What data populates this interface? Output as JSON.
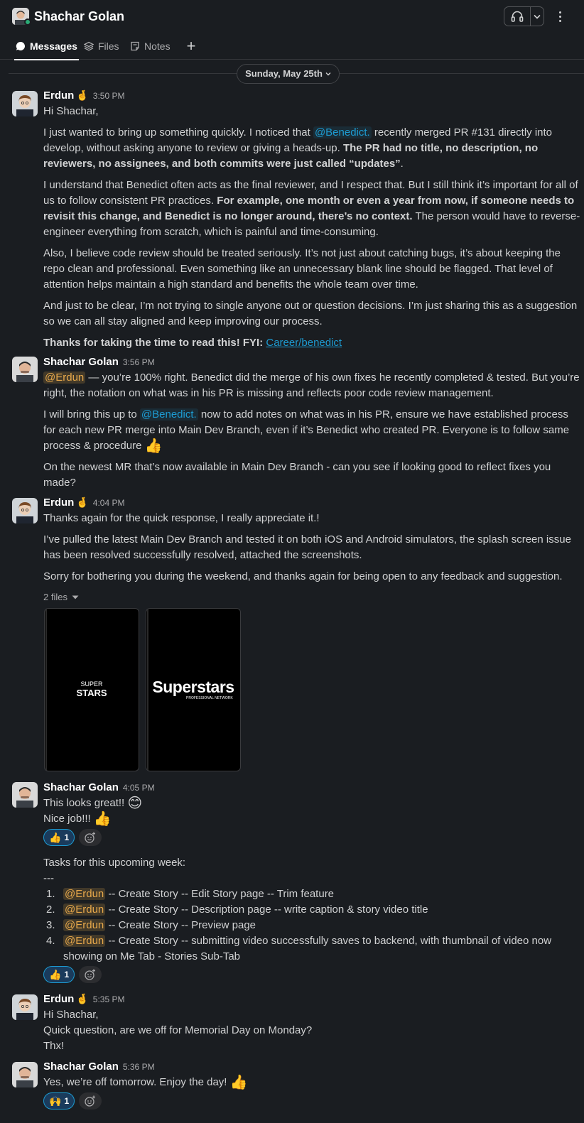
{
  "header": {
    "title": "Shachar Golan",
    "status_color": "#2bac76"
  },
  "tabs": [
    {
      "label": "Messages",
      "icon": "chat-bubble-icon",
      "active": true
    },
    {
      "label": "Files",
      "icon": "layers-icon",
      "active": false
    },
    {
      "label": "Notes",
      "icon": "note-icon",
      "active": false
    }
  ],
  "date_divider": "Sunday, May 25th",
  "messages": {
    "m1": {
      "name": "Erdun",
      "status_emoji": "🤞",
      "time": "3:50 PM",
      "greeting": "Hi Shachar,",
      "p1_a": "I just wanted to bring up something quickly. I noticed that ",
      "p1_mention": "@Benedict.",
      "p1_b": " recently merged PR #131 directly into develop, without asking anyone to review or giving a heads-up. ",
      "p1_bold": "The PR had no title, no description, no reviewers, no assignees, and both commits were just called “updates”",
      "p1_end": ".",
      "p2_a": "I understand that Benedict often acts as the final reviewer, and I respect that. But I still think it’s important for all of us to follow consistent PR practices. ",
      "p2_bold": "For example, one month or even a year from now, if someone needs to revisit this change, and Benedict is no longer around, there’s no context.",
      "p2_b": " The person would have to reverse-engineer everything from scratch, which is painful and time-consuming.",
      "p3": "Also, I believe code review should be treated seriously. It’s not just about catching bugs, it’s about keeping the repo clean and professional. Even something like an unnecessary blank line should be flagged. That level of attention helps maintain a high standard and benefits the whole team over time.",
      "p4": "And just to be clear, I’m not trying to single anyone out or question decisions. I’m just sharing this as a suggestion so we can all stay aligned and keep improving our process.",
      "p5_bold": "Thanks for taking the time to read this! FYI: ",
      "p5_link": "Career/benedict"
    },
    "m2": {
      "name": "Shachar Golan",
      "time": "3:56 PM",
      "p1_mention": "@Erdun",
      "p1": " — you’re 100% right. Benedict did the merge of his own fixes he recently completed & tested. But you’re right, the notation on what was in his PR is missing and reflects poor code review management.",
      "p2_a": "I will bring this up to ",
      "p2_mention": "@Benedict.",
      "p2_b": " now to add notes on what was in his PR, ensure we have established process for each new PR merge into Main Dev Branch, even if it’s Benedict who created PR. Everyone is to follow same process & procedure ",
      "p2_emoji": "👍",
      "p3": "On the newest MR that’s now available in Main Dev Branch - can you see if looking good to reflect fixes you made?"
    },
    "m3": {
      "name": "Erdun",
      "status_emoji": "🤞",
      "time": "4:04 PM",
      "p1": "Thanks again for the quick response, I really appreciate it.!",
      "p2": "I’ve pulled the latest Main Dev Branch and tested it on both iOS and Android simulators, the splash screen issue has been resolved successfully resolved, attached the screenshots.",
      "p3": "Sorry for bothering you during the weekend, and thanks again for being open to any feedback and suggestion.",
      "files_label": "2 files",
      "shot1_line1": "SUPER",
      "shot1_line2": "STARS",
      "shot2_title": "Superstars",
      "shot2_sub": "PROFESSIONAL NETWORK"
    },
    "m4": {
      "name": "Shachar Golan",
      "time": "4:05 PM",
      "line1": "This looks great!! ",
      "line1_emoji": "😊",
      "line2": "Nice job!!! ",
      "line2_emoji": "👍",
      "reaction1_emoji": "👍",
      "reaction1_count": "1",
      "tasks_title": "Tasks for this upcoming week:",
      "tasks_sep": "---",
      "tasks": [
        {
          "num": "1.",
          "mention": "@Erdun",
          "text": " -- Create Story -- Edit Story page -- Trim feature"
        },
        {
          "num": "2.",
          "mention": "@Erdun",
          "text": " -- Create Story -- Description page -- write caption & story video title"
        },
        {
          "num": "3.",
          "mention": "@Erdun",
          "text": " -- Create Story -- Preview page"
        },
        {
          "num": "4.",
          "mention": "@Erdun",
          "text": " -- Create Story -- submitting video successfully saves to backend, with thumbnail of video now showing on Me Tab - Stories Sub-Tab"
        }
      ],
      "reaction2_emoji": "👍",
      "reaction2_count": "1"
    },
    "m5": {
      "name": "Erdun",
      "status_emoji": "🤞",
      "time": "5:35 PM",
      "line1": "Hi Shachar,",
      "line2": "Quick question, are we off for Memorial Day on Monday?",
      "line3": "Thx!"
    },
    "m6": {
      "name": "Shachar Golan",
      "time": "5:36 PM",
      "line1": "Yes, we’re off tomorrow. Enjoy the day! ",
      "line1_emoji": "👍",
      "reaction_emoji": "🙌",
      "reaction_count": "1"
    }
  }
}
